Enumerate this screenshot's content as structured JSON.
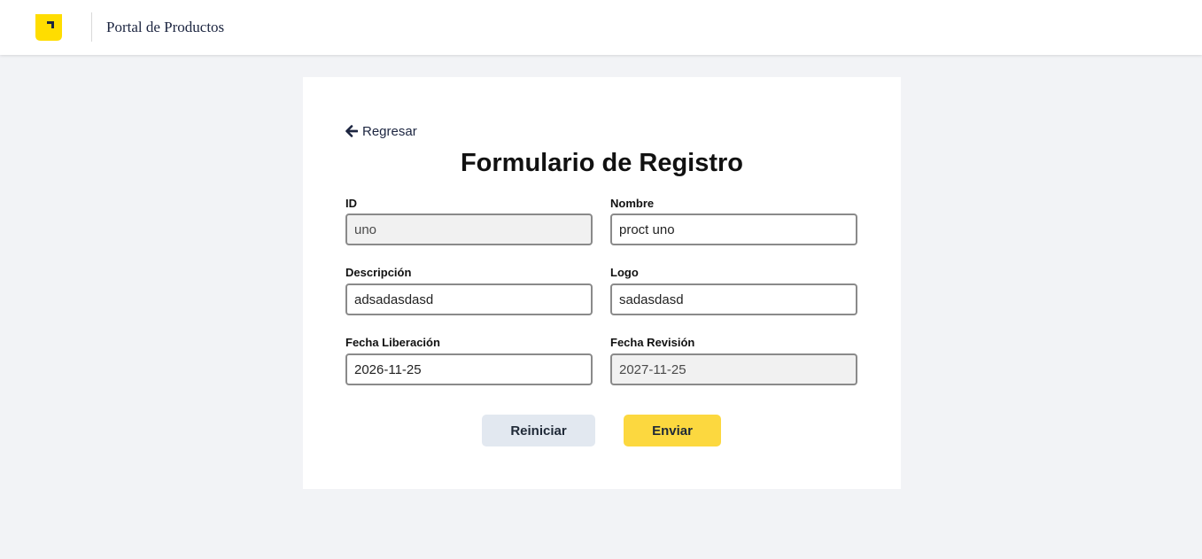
{
  "header": {
    "app_title": "Portal de Productos",
    "logo_icon": "logo-icon",
    "logo_color": "#ffdd00"
  },
  "form": {
    "back_label": "Regresar",
    "title": "Formulario de Registro",
    "fields": {
      "id": {
        "label": "ID",
        "value": "uno",
        "readonly": true
      },
      "nombre": {
        "label": "Nombre",
        "value": "proct uno",
        "readonly": false
      },
      "descripcion": {
        "label": "Descripción",
        "value": "adsadasdasd",
        "readonly": false
      },
      "logo": {
        "label": "Logo",
        "value": "sadasdasd",
        "readonly": false
      },
      "fecha_liberacion": {
        "label": "Fecha Liberación",
        "value": "2026-11-25",
        "readonly": false
      },
      "fecha_revision": {
        "label": "Fecha Revisión",
        "value": "2027-11-25",
        "readonly": true
      }
    },
    "buttons": {
      "reset_label": "Reiniciar",
      "submit_label": "Enviar"
    }
  },
  "colors": {
    "accent": "#fcd83f",
    "secondary_button": "#e2e8f0",
    "page_background": "#f2f3f6",
    "brand_text": "#1c2540"
  }
}
